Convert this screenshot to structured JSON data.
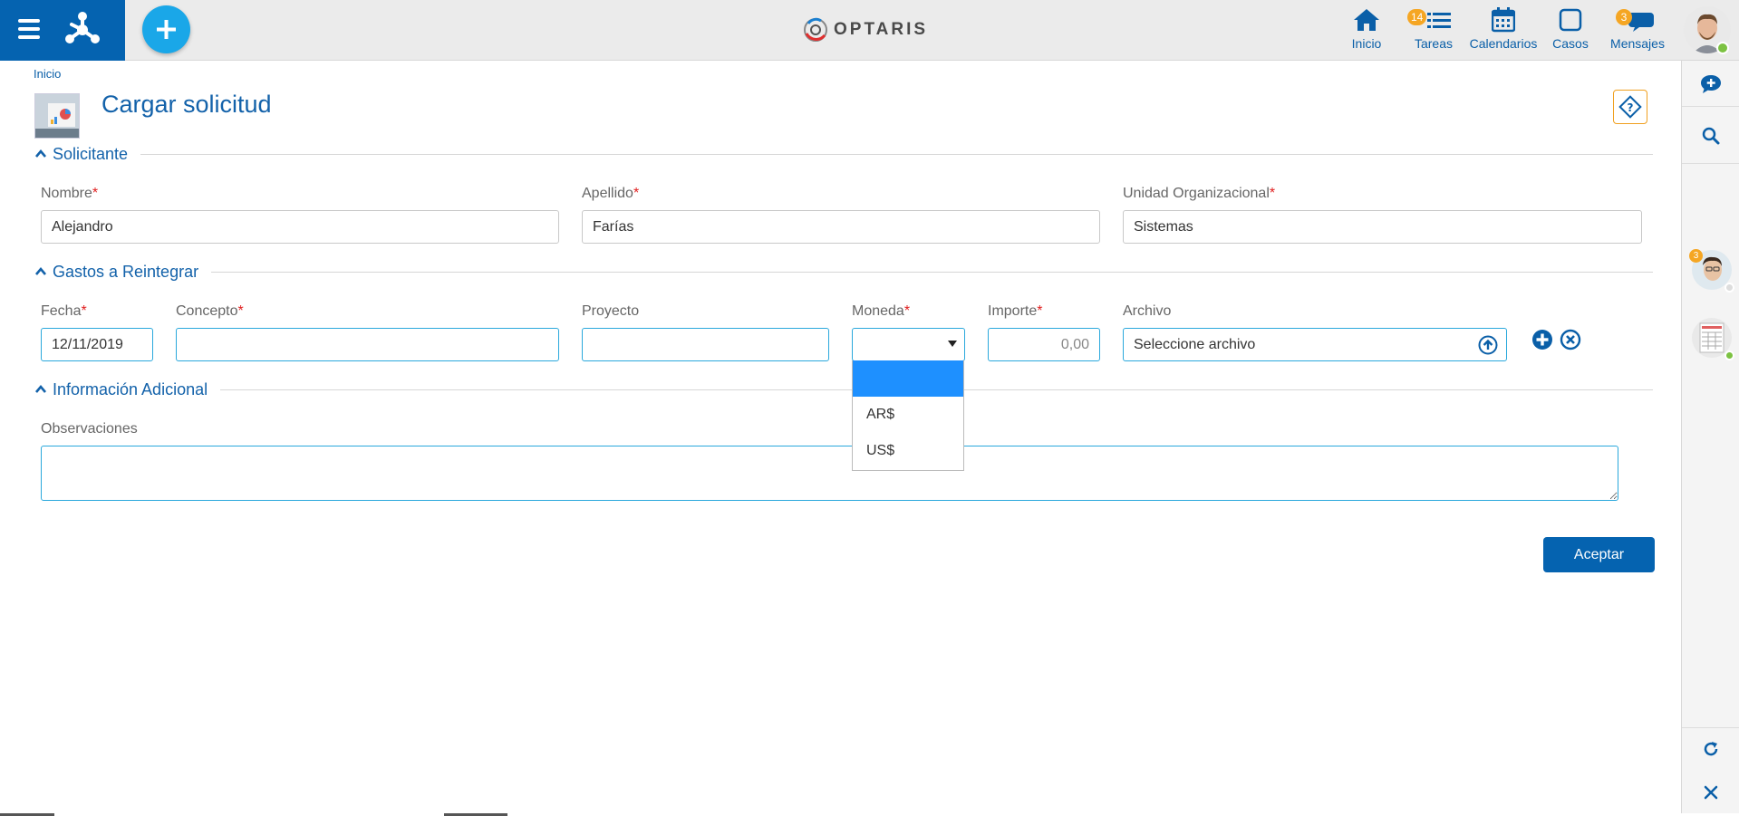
{
  "topbar": {
    "brand_name": "OPTARIS",
    "nav": [
      {
        "label": "Inicio",
        "icon": "home-icon"
      },
      {
        "label": "Tareas",
        "icon": "tasks-icon",
        "badge": "14"
      },
      {
        "label": "Calendarios",
        "icon": "calendar-icon"
      },
      {
        "label": "Casos",
        "icon": "cases-icon"
      },
      {
        "label": "Mensajes",
        "icon": "messages-icon",
        "badge": "3"
      }
    ]
  },
  "breadcrumb": "Inicio",
  "page_title": "Cargar solicitud",
  "sections": {
    "solicitante": "Solicitante",
    "gastos": "Gastos a Reintegrar",
    "info": "Información Adicional"
  },
  "solicitante": {
    "nombre_label": "Nombre",
    "nombre_value": "Alejandro",
    "apellido_label": "Apellido",
    "apellido_value": "Farías",
    "unidad_label": "Unidad Organizacional",
    "unidad_value": "Sistemas"
  },
  "gastos": {
    "fecha_label": "Fecha",
    "fecha_value": "12/11/2019",
    "concepto_label": "Concepto",
    "concepto_value": "",
    "proyecto_label": "Proyecto",
    "proyecto_value": "",
    "moneda_label": "Moneda",
    "moneda_value": "",
    "moneda_options": [
      "",
      "AR$",
      "US$"
    ],
    "importe_label": "Importe",
    "importe_placeholder": "0,00",
    "archivo_label": "Archivo",
    "archivo_value": "Seleccione archivo"
  },
  "info": {
    "observaciones_label": "Observaciones",
    "observaciones_value": ""
  },
  "accept_label": "Aceptar",
  "sidebar": {
    "avatar_badge": "3"
  },
  "colors": {
    "primary": "#0563b0",
    "accent": "#1aa7e8",
    "badge": "#f5a623",
    "required": "#e02020",
    "focus_border": "#2aa8dc"
  }
}
